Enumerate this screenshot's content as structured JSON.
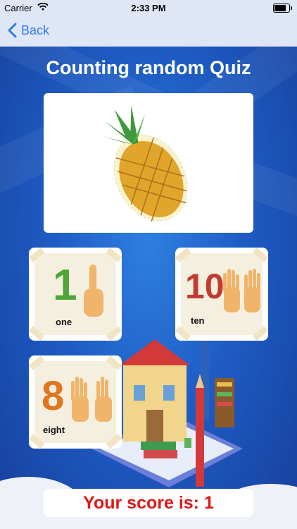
{
  "status_bar": {
    "carrier": "Carrier",
    "time": "2:33 PM",
    "battery_level": 0.9
  },
  "nav": {
    "back_label": "Back"
  },
  "quiz": {
    "title": "Counting random Quiz",
    "question_image": "pineapple",
    "answers": [
      {
        "number": "1",
        "word": "one"
      },
      {
        "number": "10",
        "word": "ten"
      },
      {
        "number": "8",
        "word": "eight"
      }
    ]
  },
  "score_text": "Your score is: 1",
  "colors": {
    "nav_bg": "#dfe6f6",
    "back_accent": "#2c7cf6",
    "background_blue": "#1f5fc0",
    "score_red": "#e01717",
    "number_one": "#4ea63a",
    "number_ten": "#c23b33",
    "number_eight": "#e0761e"
  }
}
